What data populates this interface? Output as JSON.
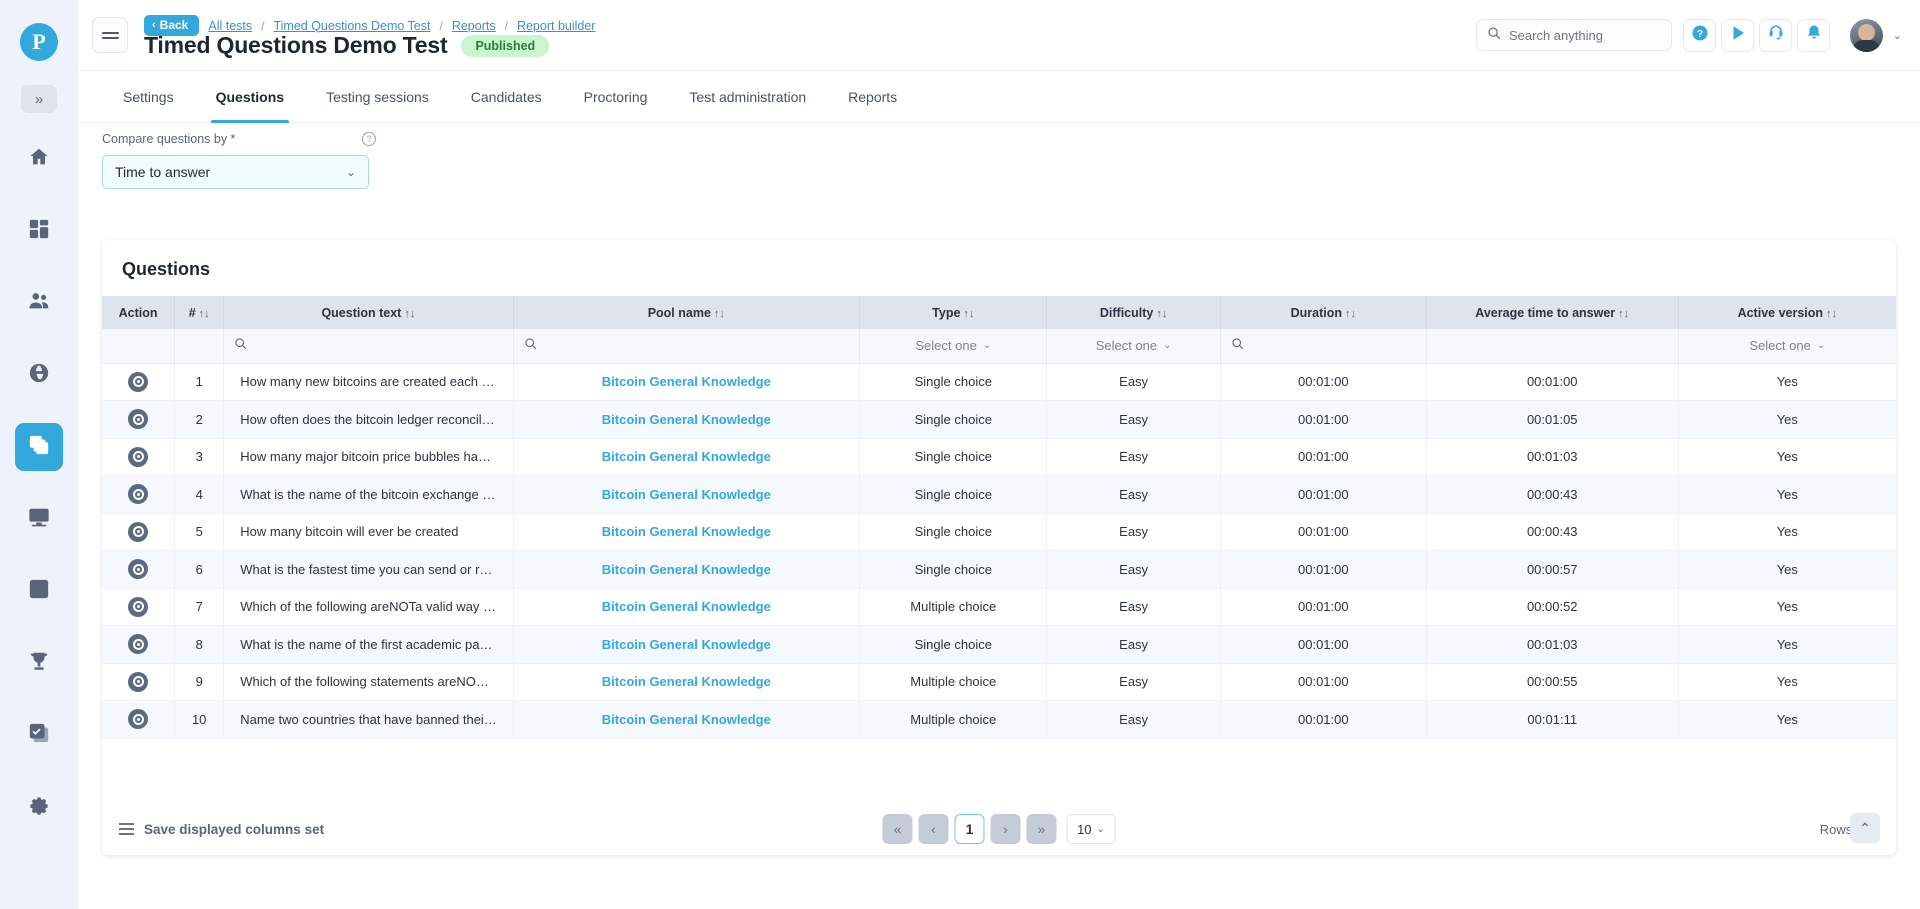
{
  "rail": {
    "logo_label": "P",
    "expand_label": "»",
    "items": [
      {
        "name": "home",
        "icon": "home-icon"
      },
      {
        "name": "dashboard",
        "icon": "dashboard-icon"
      },
      {
        "name": "users",
        "icon": "users-icon"
      },
      {
        "name": "globe",
        "icon": "globe-icon"
      },
      {
        "name": "tests",
        "icon": "layers-icon",
        "active": true
      },
      {
        "name": "monitor",
        "icon": "monitor-list-icon"
      },
      {
        "name": "lists",
        "icon": "list-icon"
      },
      {
        "name": "awards",
        "icon": "trophy-icon"
      },
      {
        "name": "tasks",
        "icon": "checkbox-stack-icon"
      },
      {
        "name": "settings",
        "icon": "gear-icon"
      }
    ]
  },
  "header": {
    "back_label": "Back",
    "breadcrumbs": [
      "All tests",
      "Timed Questions Demo Test",
      "Reports",
      "Report builder"
    ],
    "title": "Timed Questions Demo Test",
    "status": "Published",
    "search_placeholder": "Search anything",
    "search_value": "",
    "buttons": [
      {
        "name": "help-button",
        "icon": "question-mark-icon"
      },
      {
        "name": "play-button",
        "icon": "play-icon"
      },
      {
        "name": "support-button",
        "icon": "headset-icon"
      },
      {
        "name": "notifications-button",
        "icon": "bell-icon"
      }
    ]
  },
  "tabs": [
    {
      "label": "Settings",
      "active": false
    },
    {
      "label": "Questions",
      "active": true
    },
    {
      "label": "Testing sessions",
      "active": false
    },
    {
      "label": "Candidates",
      "active": false
    },
    {
      "label": "Proctoring",
      "active": false
    },
    {
      "label": "Test administration",
      "active": false
    },
    {
      "label": "Reports",
      "active": false
    }
  ],
  "compare": {
    "label": "Compare questions by *",
    "value": "Time to answer",
    "caret": "⌄"
  },
  "panel": {
    "title": "Questions",
    "columns": [
      {
        "label": "Action",
        "sortable": false
      },
      {
        "label": "#",
        "sortable": true
      },
      {
        "label": "Question text",
        "sortable": true
      },
      {
        "label": "Pool name",
        "sortable": true
      },
      {
        "label": "Type",
        "sortable": true
      },
      {
        "label": "Difficulty",
        "sortable": true
      },
      {
        "label": "Duration",
        "sortable": true
      },
      {
        "label": "Average time to answer",
        "sortable": true
      },
      {
        "label": "Active version",
        "sortable": true
      }
    ],
    "filters": {
      "question_text": "search-icon",
      "pool_name": "search-icon",
      "type": "Select one",
      "difficulty": "Select one",
      "duration": "search-icon",
      "active_version": "Select one"
    },
    "rows": [
      {
        "num": "1",
        "question": "How many new bitcoins are created each …",
        "pool": "Bitcoin General Knowledge",
        "type": "Single choice",
        "difficulty": "Easy",
        "duration": "00:01:00",
        "avg": "00:01:00",
        "active": "Yes"
      },
      {
        "num": "2",
        "question": "How often does the bitcoin ledger reconcil…",
        "pool": "Bitcoin General Knowledge",
        "type": "Single choice",
        "difficulty": "Easy",
        "duration": "00:01:00",
        "avg": "00:01:05",
        "active": "Yes"
      },
      {
        "num": "3",
        "question": "How many major bitcoin price bubbles ha…",
        "pool": "Bitcoin General Knowledge",
        "type": "Single choice",
        "difficulty": "Easy",
        "duration": "00:01:00",
        "avg": "00:01:03",
        "active": "Yes"
      },
      {
        "num": "4",
        "question": "What is the name of the bitcoin exchange …",
        "pool": "Bitcoin General Knowledge",
        "type": "Single choice",
        "difficulty": "Easy",
        "duration": "00:01:00",
        "avg": "00:00:43",
        "active": "Yes"
      },
      {
        "num": "5",
        "question": "How many bitcoin will ever be created",
        "pool": "Bitcoin General Knowledge",
        "type": "Single choice",
        "difficulty": "Easy",
        "duration": "00:01:00",
        "avg": "00:00:43",
        "active": "Yes"
      },
      {
        "num": "6",
        "question": "What is the fastest time you can send or r…",
        "pool": "Bitcoin General Knowledge",
        "type": "Single choice",
        "difficulty": "Easy",
        "duration": "00:01:00",
        "avg": "00:00:57",
        "active": "Yes"
      },
      {
        "num": "7",
        "question": "Which of the following areNOTa valid way …",
        "pool": "Bitcoin General Knowledge",
        "type": "Multiple choice",
        "difficulty": "Easy",
        "duration": "00:01:00",
        "avg": "00:00:52",
        "active": "Yes"
      },
      {
        "num": "8",
        "question": "What is the name of the first academic pa…",
        "pool": "Bitcoin General Knowledge",
        "type": "Single choice",
        "difficulty": "Easy",
        "duration": "00:01:00",
        "avg": "00:01:03",
        "active": "Yes"
      },
      {
        "num": "9",
        "question": "Which of the following statements areNO…",
        "pool": "Bitcoin General Knowledge",
        "type": "Multiple choice",
        "difficulty": "Easy",
        "duration": "00:01:00",
        "avg": "00:00:55",
        "active": "Yes"
      },
      {
        "num": "10",
        "question": "Name two countries that have banned thei…",
        "pool": "Bitcoin General Knowledge",
        "type": "Multiple choice",
        "difficulty": "Easy",
        "duration": "00:01:00",
        "avg": "00:01:11",
        "active": "Yes"
      }
    ]
  },
  "footer": {
    "save_columns_label": "Save displayed columns set",
    "pager": {
      "first": "«",
      "prev": "‹",
      "current": "1",
      "next": "›",
      "last": "»",
      "rows_per_page": "10",
      "caret": "⌄"
    },
    "rows_total": "Rows: 10",
    "scroll_top": "⌃"
  },
  "colors": {
    "accent": "#33a8dd",
    "badge_bg": "#c9f6cf",
    "badge_text": "#2b7a3c",
    "header_bg": "#dfe3eb",
    "row_alt": "#f5f8fd"
  }
}
